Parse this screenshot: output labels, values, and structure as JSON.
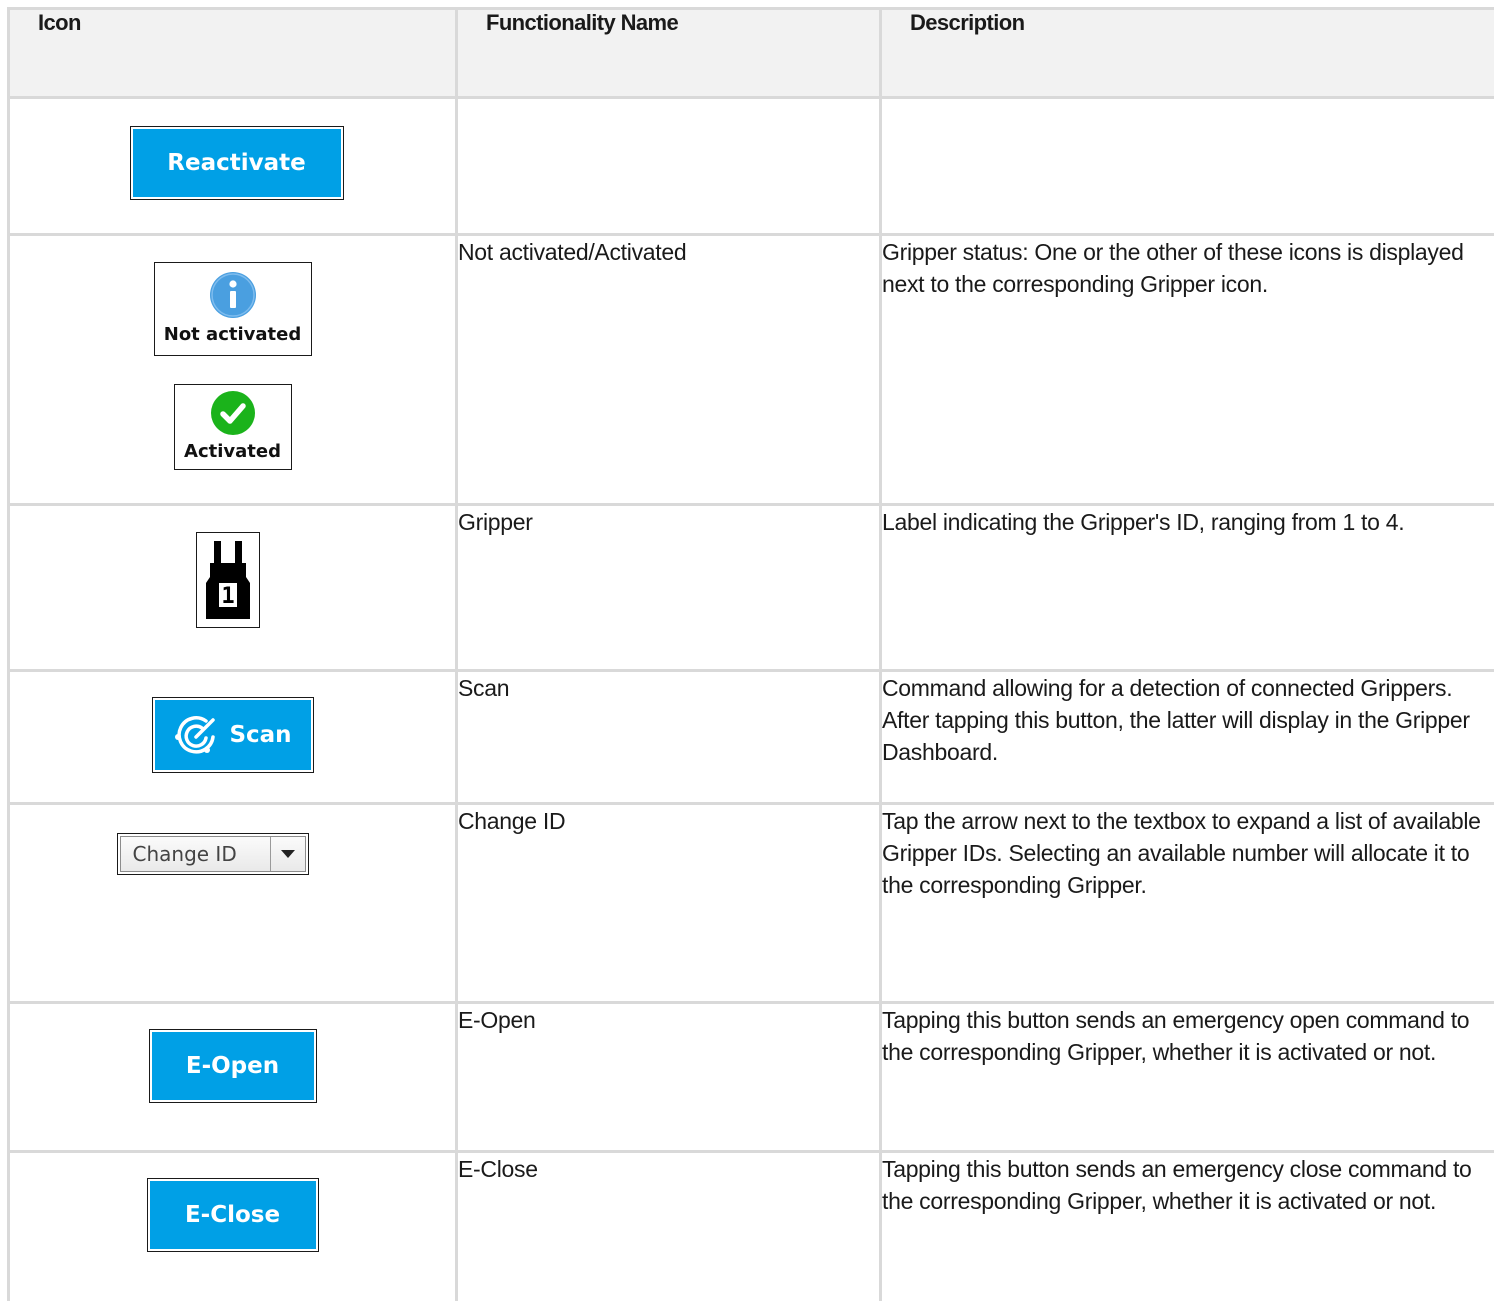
{
  "table": {
    "headers": {
      "icon": "Icon",
      "name": "Functionality Name",
      "description": "Description"
    },
    "rows": {
      "reactivate": {
        "button_label": "Reactivate",
        "name": "",
        "description": ""
      },
      "status": {
        "not_activated_label": "Not activated",
        "activated_label": "Activated",
        "name": "Not activated/Activated",
        "description": "Gripper status: One or the other of these icons is displayed next to the corresponding Gripper icon."
      },
      "gripper": {
        "id_digit": "1",
        "name": "Gripper",
        "description": "Label indicating the Gripper's ID, ranging from 1 to 4."
      },
      "scan": {
        "button_label": "Scan",
        "name": "Scan",
        "description": "Command allowing for a detection of connected Grippers. After tapping this button, the latter will display in the Gripper Dashboard."
      },
      "change_id": {
        "combo_label": "Change ID",
        "name": "Change ID",
        "description": "Tap the arrow next to the textbox to expand a list of available Gripper IDs. Selecting an available number will allocate it to the corresponding Gripper."
      },
      "e_open": {
        "button_label": "E-Open",
        "name": "E-Open",
        "description": "Tapping this button sends an emergency open command to the corresponding Gripper, whether it is activated or not."
      },
      "e_close": {
        "button_label": "E-Close",
        "name": "E-Close",
        "description": "Tapping this button sends an emergency close command to the corresponding Gripper, whether it is activated or not."
      }
    }
  },
  "icons": {
    "info": "info-icon",
    "check": "check-icon",
    "gripper": "gripper-icon",
    "scan": "radar-scan-icon",
    "dropdown": "chevron-down-icon"
  },
  "colors": {
    "button_blue": "#00a0e6",
    "info_blue": "#4a9fe0",
    "check_green": "#1bb31b",
    "header_bg": "#f2f2f2",
    "grid_line": "#d9d9d9"
  }
}
